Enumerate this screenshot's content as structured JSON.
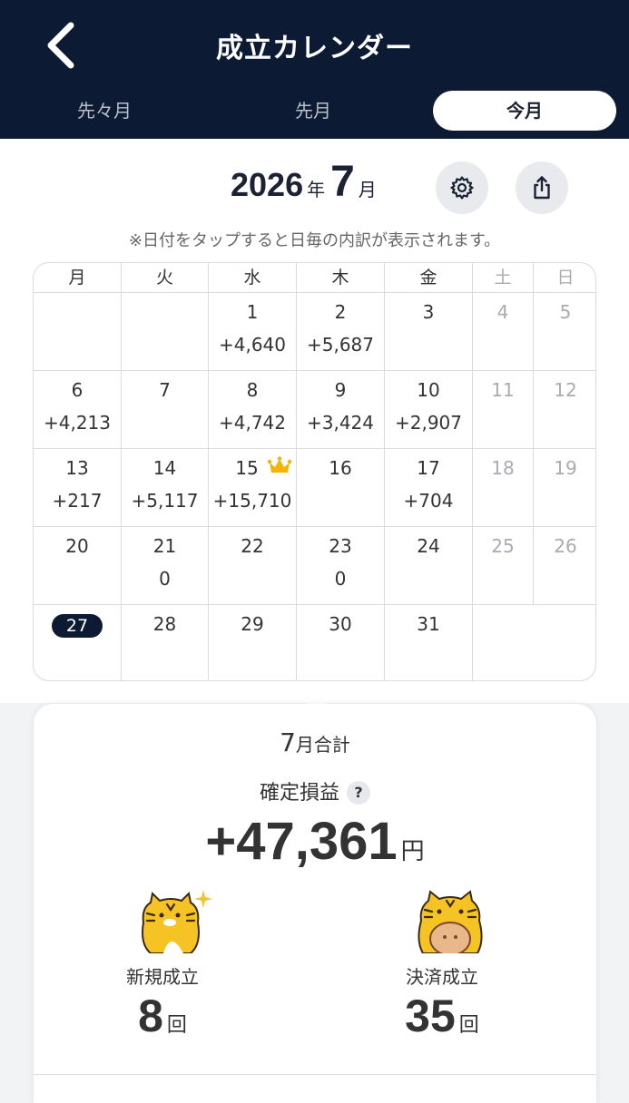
{
  "header": {
    "title": "成立カレンダー",
    "tabs": [
      {
        "label": "先々月",
        "active": false
      },
      {
        "label": "先月",
        "active": false
      },
      {
        "label": "今月",
        "active": true
      }
    ]
  },
  "month_nav": {
    "year": "2026",
    "year_unit": "年",
    "month": "7",
    "month_unit": "月"
  },
  "note": "※日付をタップすると日毎の内訳が表示されます。",
  "calendar": {
    "weekdays": [
      "月",
      "火",
      "水",
      "木",
      "金",
      "土",
      "日"
    ],
    "weeks": [
      [
        {
          "day": "",
          "value": ""
        },
        {
          "day": "",
          "value": ""
        },
        {
          "day": "1",
          "value": "+4,640"
        },
        {
          "day": "2",
          "value": "+5,687"
        },
        {
          "day": "3",
          "value": ""
        },
        {
          "day": "4",
          "value": ""
        },
        {
          "day": "5",
          "value": ""
        }
      ],
      [
        {
          "day": "6",
          "value": "+4,213"
        },
        {
          "day": "7",
          "value": ""
        },
        {
          "day": "8",
          "value": "+4,742"
        },
        {
          "day": "9",
          "value": "+3,424"
        },
        {
          "day": "10",
          "value": "+2,907"
        },
        {
          "day": "11",
          "value": ""
        },
        {
          "day": "12",
          "value": ""
        }
      ],
      [
        {
          "day": "13",
          "value": "+217"
        },
        {
          "day": "14",
          "value": "+5,117"
        },
        {
          "day": "15",
          "value": "+15,710",
          "crown": true
        },
        {
          "day": "16",
          "value": ""
        },
        {
          "day": "17",
          "value": "+704"
        },
        {
          "day": "18",
          "value": ""
        },
        {
          "day": "19",
          "value": ""
        }
      ],
      [
        {
          "day": "20",
          "value": ""
        },
        {
          "day": "21",
          "value": "0"
        },
        {
          "day": "22",
          "value": ""
        },
        {
          "day": "23",
          "value": "0"
        },
        {
          "day": "24",
          "value": ""
        },
        {
          "day": "25",
          "value": ""
        },
        {
          "day": "26",
          "value": ""
        }
      ],
      [
        {
          "day": "27",
          "value": "",
          "today": true
        },
        {
          "day": "28",
          "value": ""
        },
        {
          "day": "29",
          "value": ""
        },
        {
          "day": "30",
          "value": ""
        },
        {
          "day": "31",
          "value": ""
        },
        {
          "day": "",
          "value": ""
        },
        {
          "day": "",
          "value": ""
        }
      ]
    ]
  },
  "summary": {
    "month": "7",
    "title_suffix": "月合計",
    "pl_label": "確定損益",
    "help_label": "?",
    "pl_value": "+47,361",
    "pl_unit": "円",
    "new_label": "新規成立",
    "new_count": "8",
    "close_label": "決済成立",
    "close_count": "35",
    "count_unit": "回"
  },
  "icons": [
    "back-chevron-icon",
    "gear-icon",
    "share-icon",
    "crown-icon",
    "tiger-mascot-icon"
  ],
  "colors": {
    "header_bg": "#0c1b33",
    "crown": "#f4b400",
    "mascot": "#f6c324"
  }
}
